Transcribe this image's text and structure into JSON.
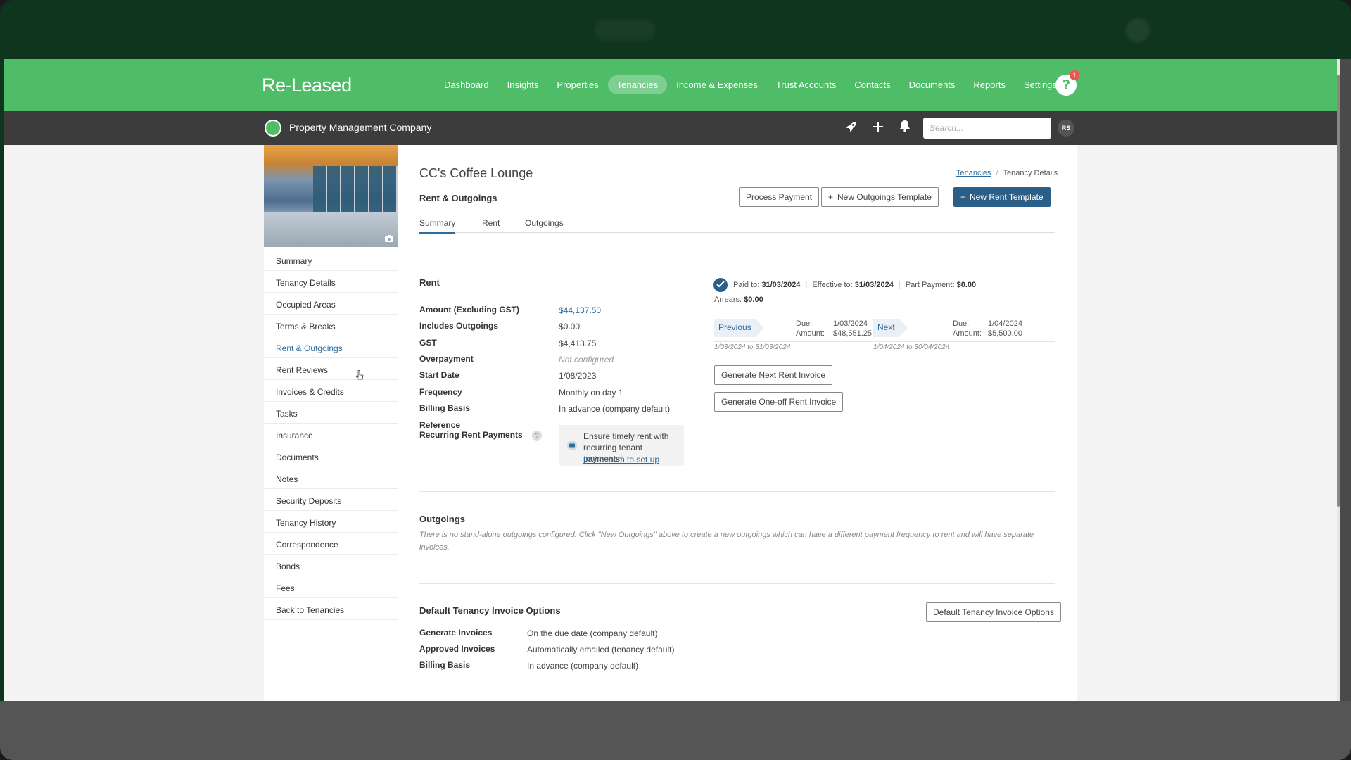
{
  "app": {
    "brand": "Re-Leased",
    "nav": [
      {
        "label": "Dashboard"
      },
      {
        "label": "Insights"
      },
      {
        "label": "Properties"
      },
      {
        "label": "Tenancies",
        "active": true
      },
      {
        "label": "Income & Expenses"
      },
      {
        "label": "Trust Accounts"
      },
      {
        "label": "Contacts"
      },
      {
        "label": "Documents"
      },
      {
        "label": "Reports"
      },
      {
        "label": "Settings"
      }
    ],
    "help_badge": "1",
    "org_name": "Property Management Company",
    "search_placeholder": "Search...",
    "avatar_initials": "RS",
    "accent_color": "#4fbd68"
  },
  "sidebar": {
    "items": [
      "Summary",
      "Tenancy Details",
      "Occupied Areas",
      "Terms & Breaks",
      "Rent & Outgoings",
      "Rent Reviews",
      "Invoices & Credits",
      "Tasks",
      "Insurance",
      "Documents",
      "Notes",
      "Security Deposits",
      "Tenancy History",
      "Correspondence",
      "Bonds",
      "Fees",
      "Back to Tenancies"
    ],
    "active_index": 4
  },
  "page": {
    "title": "CC's Coffee Lounge",
    "breadcrumb": {
      "link": "Tenancies",
      "sep": "/",
      "current": "Tenancy Details"
    },
    "section_title": "Rent & Outgoings",
    "buttons": {
      "process_payment": "Process Payment",
      "new_outgoings_template": "New Outgoings Template",
      "new_rent_template": "New Rent Template"
    },
    "tabs": [
      "Summary",
      "Rent",
      "Outgoings"
    ],
    "active_tab": 0
  },
  "rent": {
    "heading": "Rent",
    "fields": [
      {
        "label": "Amount (Excluding GST)",
        "value": "$44,137.50",
        "style": "link"
      },
      {
        "label": "Includes Outgoings",
        "value": "$0.00"
      },
      {
        "label": "GST",
        "value": "$4,413.75"
      },
      {
        "label": "Overpayment",
        "value": "Not configured",
        "style": "muted"
      },
      {
        "label": "Start Date",
        "value": "1/08/2023"
      },
      {
        "label": "Frequency",
        "value": "Monthly on day 1"
      },
      {
        "label": "Billing Basis",
        "value": "In advance (company default)"
      },
      {
        "label": "Reference",
        "value": ""
      },
      {
        "label": "Recurring Rent Payments",
        "value": ""
      }
    ],
    "promo": {
      "text": "Ensure timely rent with recurring tenant payments!",
      "link": "Invite them to set up"
    },
    "status": {
      "paid_to_label": "Paid to:",
      "paid_to": "31/03/2024",
      "effective_to_label": "Effective to:",
      "effective_to": "31/03/2024",
      "part_payment_label": "Part Payment:",
      "part_payment": "$0.00",
      "arrears_label": "Arrears:",
      "arrears": "$0.00"
    },
    "previous": {
      "label": "Previous",
      "due_label": "Due:",
      "due": "1/03/2024",
      "amount_label": "Amount:",
      "amount": "$48,551.25",
      "range": "1/03/2024 to 31/03/2024"
    },
    "next": {
      "label": "Next",
      "due_label": "Due:",
      "due": "1/04/2024",
      "amount_label": "Amount:",
      "amount": "$5,500.00",
      "range": "1/04/2024 to 30/04/2024"
    },
    "generate_next": "Generate Next Rent Invoice",
    "generate_oneoff": "Generate One-off Rent Invoice"
  },
  "outgoings": {
    "heading": "Outgoings",
    "note": "There is no stand-alone outgoings configured. Click \"New Outgoings\" above to create a new outgoings which can have a different payment frequency to rent and will have separate invoices."
  },
  "invoice_options": {
    "heading": "Default Tenancy Invoice Options",
    "button": "Default Tenancy Invoice Options",
    "fields": [
      {
        "label": "Generate Invoices",
        "value": "On the due date (company default)"
      },
      {
        "label": "Approved Invoices",
        "value": "Automatically emailed (tenancy default)"
      },
      {
        "label": "Billing Basis",
        "value": "In advance (company default)"
      }
    ]
  }
}
